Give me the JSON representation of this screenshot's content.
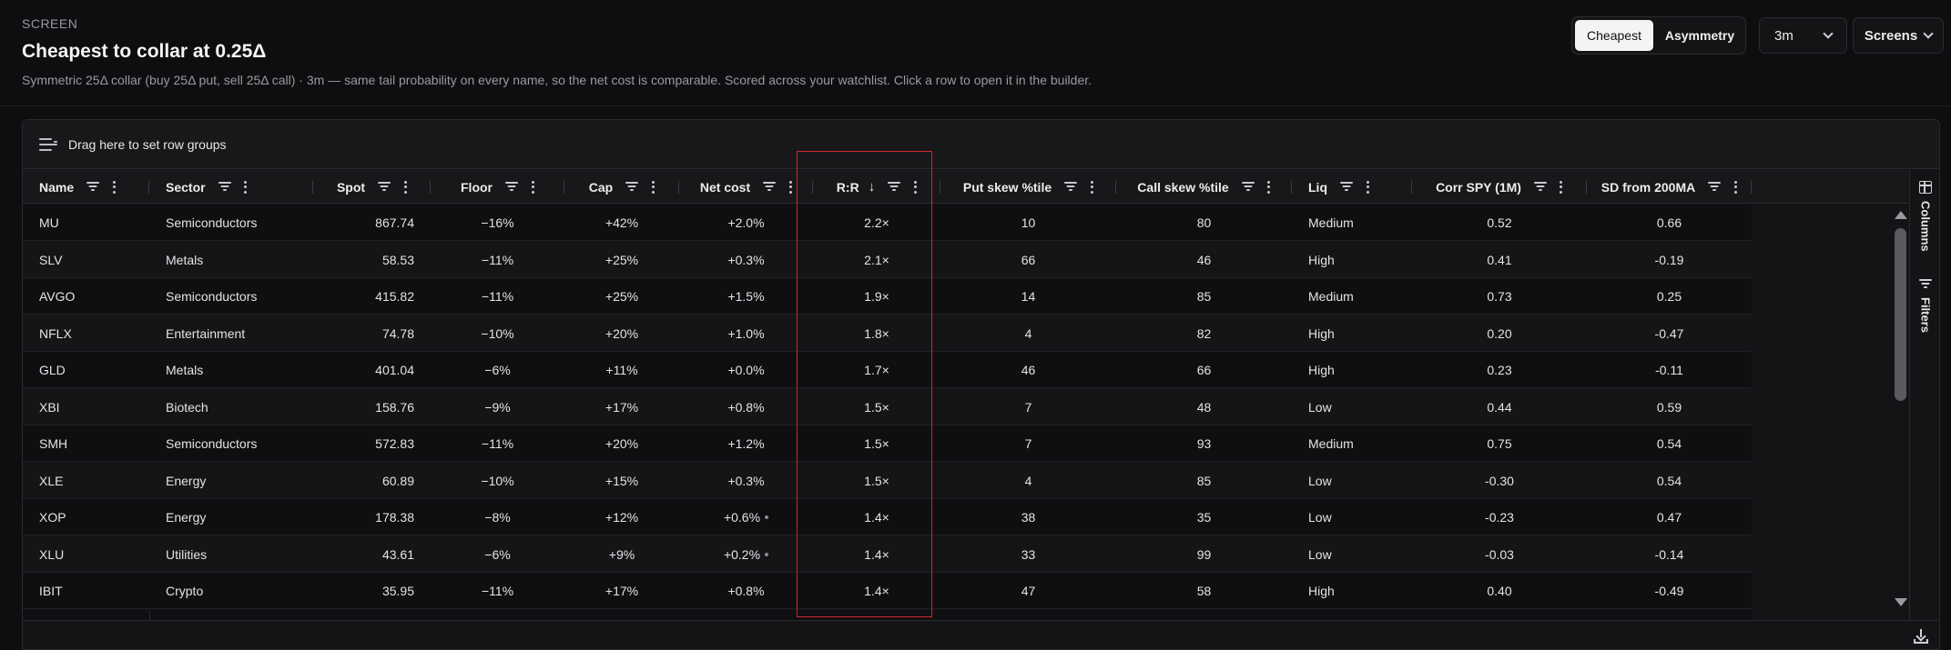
{
  "header": {
    "eyebrow": "SCREEN",
    "title": "Cheapest to collar at 0.25Δ",
    "subtitle": "Symmetric 25Δ collar (buy 25Δ put, sell 25Δ call) · 3m — same tail probability on every name, so the net cost is comparable. Scored across your watchlist. Click a row to open it in the builder."
  },
  "controls": {
    "segments": [
      {
        "label": "Cheapest",
        "active": true
      },
      {
        "label": "Asymmetry",
        "active": false
      }
    ],
    "period": "3m",
    "screens_label": "Screens"
  },
  "grid": {
    "row_group_hint": "Drag here to set row groups",
    "columns": [
      {
        "key": "name",
        "label": "Name"
      },
      {
        "key": "sector",
        "label": "Sector"
      },
      {
        "key": "spot",
        "label": "Spot"
      },
      {
        "key": "floor",
        "label": "Floor"
      },
      {
        "key": "cap",
        "label": "Cap"
      },
      {
        "key": "net",
        "label": "Net cost"
      },
      {
        "key": "rr",
        "label": "R:R",
        "sort": "↓"
      },
      {
        "key": "put",
        "label": "Put skew %tile"
      },
      {
        "key": "call",
        "label": "Call skew %tile"
      },
      {
        "key": "liq",
        "label": "Liq"
      },
      {
        "key": "corr",
        "label": "Corr SPY (1M)"
      },
      {
        "key": "sd",
        "label": "SD from 200MA"
      }
    ],
    "rows": [
      {
        "name": "MU",
        "sector": "Semiconductors",
        "spot": "867.74",
        "floor": "−16%",
        "cap": "+42%",
        "net": "+2.0%",
        "rr": "2.2×",
        "put": "10",
        "call": "80",
        "liq": "Medium",
        "corr": "0.52",
        "sd": "0.66",
        "flag": false
      },
      {
        "name": "SLV",
        "sector": "Metals",
        "spot": "58.53",
        "floor": "−11%",
        "cap": "+25%",
        "net": "+0.3%",
        "rr": "2.1×",
        "put": "66",
        "call": "46",
        "liq": "High",
        "corr": "0.41",
        "sd": "-0.19",
        "flag": false
      },
      {
        "name": "AVGO",
        "sector": "Semiconductors",
        "spot": "415.82",
        "floor": "−11%",
        "cap": "+25%",
        "net": "+1.5%",
        "rr": "1.9×",
        "put": "14",
        "call": "85",
        "liq": "Medium",
        "corr": "0.73",
        "sd": "0.25",
        "flag": false
      },
      {
        "name": "NFLX",
        "sector": "Entertainment",
        "spot": "74.78",
        "floor": "−10%",
        "cap": "+20%",
        "net": "+1.0%",
        "rr": "1.8×",
        "put": "4",
        "call": "82",
        "liq": "High",
        "corr": "0.20",
        "sd": "-0.47",
        "flag": false
      },
      {
        "name": "GLD",
        "sector": "Metals",
        "spot": "401.04",
        "floor": "−6%",
        "cap": "+11%",
        "net": "+0.0%",
        "rr": "1.7×",
        "put": "46",
        "call": "66",
        "liq": "High",
        "corr": "0.23",
        "sd": "-0.11",
        "flag": false
      },
      {
        "name": "XBI",
        "sector": "Biotech",
        "spot": "158.76",
        "floor": "−9%",
        "cap": "+17%",
        "net": "+0.8%",
        "rr": "1.5×",
        "put": "7",
        "call": "48",
        "liq": "Low",
        "corr": "0.44",
        "sd": "0.59",
        "flag": false
      },
      {
        "name": "SMH",
        "sector": "Semiconductors",
        "spot": "572.83",
        "floor": "−11%",
        "cap": "+20%",
        "net": "+1.2%",
        "rr": "1.5×",
        "put": "7",
        "call": "93",
        "liq": "Medium",
        "corr": "0.75",
        "sd": "0.54",
        "flag": false
      },
      {
        "name": "XLE",
        "sector": "Energy",
        "spot": "60.89",
        "floor": "−10%",
        "cap": "+15%",
        "net": "+0.3%",
        "rr": "1.5×",
        "put": "4",
        "call": "85",
        "liq": "Low",
        "corr": "-0.30",
        "sd": "0.54",
        "flag": false
      },
      {
        "name": "XOP",
        "sector": "Energy",
        "spot": "178.38",
        "floor": "−8%",
        "cap": "+12%",
        "net": "+0.6%",
        "rr": "1.4×",
        "put": "38",
        "call": "35",
        "liq": "Low",
        "corr": "-0.23",
        "sd": "0.47",
        "flag": true
      },
      {
        "name": "XLU",
        "sector": "Utilities",
        "spot": "43.61",
        "floor": "−6%",
        "cap": "+9%",
        "net": "+0.2%",
        "rr": "1.4×",
        "put": "33",
        "call": "99",
        "liq": "Low",
        "corr": "-0.03",
        "sd": "-0.14",
        "flag": true
      },
      {
        "name": "IBIT",
        "sector": "Crypto",
        "spot": "35.95",
        "floor": "−11%",
        "cap": "+17%",
        "net": "+0.8%",
        "rr": "1.4×",
        "put": "47",
        "call": "58",
        "liq": "High",
        "corr": "0.40",
        "sd": "-0.49",
        "flag": false
      }
    ]
  },
  "side_panel": {
    "columns_label": "Columns",
    "filters_label": "Filters"
  },
  "icons": {
    "row_group": "row-group-icon",
    "filter": "filter-icon",
    "menu": "kebab-menu-icon",
    "sort": "sort-desc-icon",
    "columns": "columns-icon",
    "filters": "filters-icon",
    "download": "download-icon"
  },
  "colors": {
    "background": "#0e0e10",
    "highlight": "#d0262e"
  }
}
